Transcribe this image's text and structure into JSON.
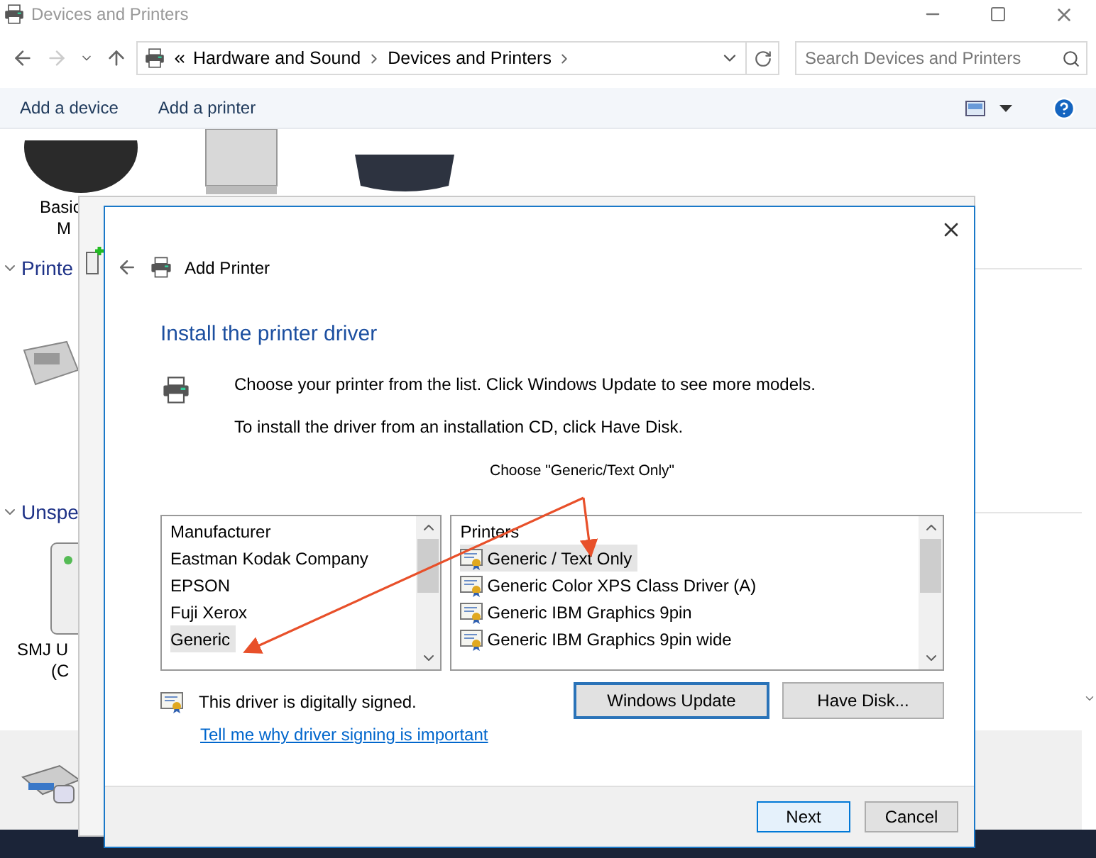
{
  "explorer": {
    "title": "Devices and Printers",
    "breadcrumb": [
      "Hardware and Sound",
      "Devices and Printers"
    ],
    "search": {
      "placeholder": "Search Devices and Printers"
    },
    "commands": [
      "Add a device",
      "Add a printer"
    ],
    "device_labels": [
      "Basic",
      "M"
    ],
    "sections": [
      "Printe",
      "Unspe"
    ],
    "bottom_labels": [
      "SMJ U",
      "(C"
    ]
  },
  "dialog": {
    "title": "Add Printer",
    "heading": "Install the printer driver",
    "instructions": [
      "Choose your printer from the list. Click Windows Update to see more models.",
      "To install the driver from an installation CD, click Have Disk."
    ],
    "annotation": "Choose \"Generic/Text Only\"",
    "manufacturers": {
      "header": "Manufacturer",
      "items": [
        {
          "label": "Eastman Kodak Company",
          "selected": false
        },
        {
          "label": "EPSON",
          "selected": false
        },
        {
          "label": "Fuji Xerox",
          "selected": false
        },
        {
          "label": "Generic",
          "selected": true
        }
      ]
    },
    "printers": {
      "header": "Printers",
      "items": [
        {
          "label": "Generic / Text Only",
          "selected": true
        },
        {
          "label": "Generic Color XPS Class Driver (A)",
          "selected": false
        },
        {
          "label": "Generic IBM Graphics 9pin",
          "selected": false
        },
        {
          "label": "Generic IBM Graphics 9pin wide",
          "selected": false
        }
      ]
    },
    "signature": "This driver is digitally signed.",
    "link": "Tell me why driver signing is important",
    "buttons": [
      {
        "label": "Windows Update",
        "focused": true
      },
      {
        "label": "Have Disk...",
        "focused": false
      }
    ],
    "footer_buttons": [
      {
        "label": "Next",
        "default": true
      },
      {
        "label": "Cancel",
        "default": false
      }
    ]
  }
}
